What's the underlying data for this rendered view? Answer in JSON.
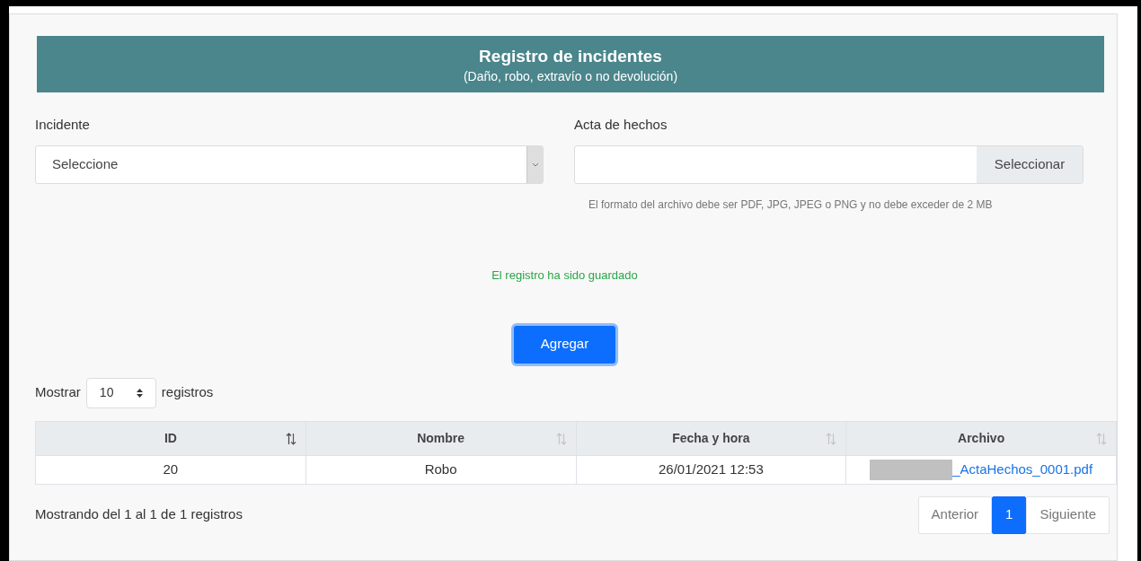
{
  "header": {
    "title": "Registro de incidentes",
    "subtitle": "(Daño, robo, extravío o no devolución)"
  },
  "incident_field": {
    "label": "Incidente",
    "value": "Seleccione"
  },
  "file_field": {
    "label": "Acta de hechos",
    "button": "Seleccionar",
    "hint": "El formato del archivo debe ser PDF, JPG, JPEG o PNG y no debe exceder de 2 MB"
  },
  "success_message": "El registro ha sido guardado",
  "add_button": "Agregar",
  "length_control": {
    "before": "Mostrar",
    "value": "10",
    "after": "registros"
  },
  "table": {
    "columns": [
      {
        "label": "ID",
        "sorted": true
      },
      {
        "label": "Nombre",
        "sorted": false
      },
      {
        "label": "Fecha y hora",
        "sorted": false
      },
      {
        "label": "Archivo",
        "sorted": false
      }
    ],
    "rows": [
      {
        "id": "20",
        "nombre": "Robo",
        "fecha": "26/01/2021 12:53",
        "archivo": "_ActaHechos_0001.pdf",
        "archivo_redacted": true
      }
    ]
  },
  "info": "Mostrando del 1 al 1 de 1 registros",
  "pagination": [
    {
      "label": "Anterior",
      "selected": false
    },
    {
      "label": "1",
      "selected": true
    },
    {
      "label": "Siguiente",
      "selected": false
    }
  ]
}
